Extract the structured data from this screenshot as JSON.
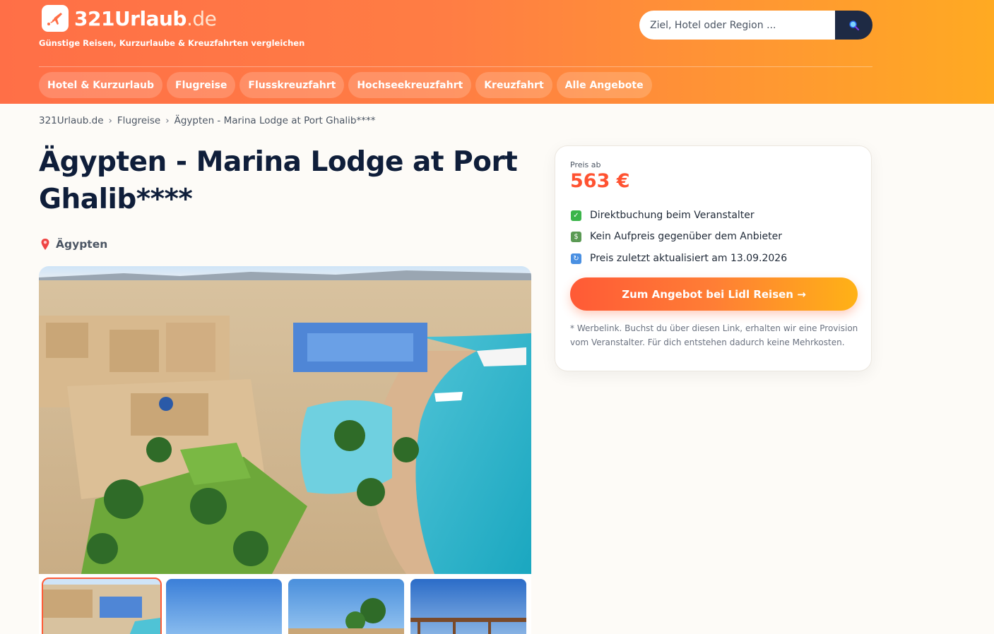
{
  "brand": {
    "name": "321Urlaub",
    "tld": ".de",
    "tagline": "Günstige Reisen, Kurzurlaube & Kreuzfahrten vergleichen"
  },
  "search": {
    "placeholder": "Ziel, Hotel oder Region ...",
    "value": "",
    "button_icon": "search-icon"
  },
  "nav": [
    "Hotel & Kurzurlaub",
    "Flugreise",
    "Flusskreuzfahrt",
    "Hochseekreuzfahrt",
    "Kreuzfahrt",
    "Alle Angebote"
  ],
  "breadcrumb": [
    "321Urlaub.de",
    "Flugreise",
    "Ägypten - Marina Lodge at Port Ghalib****"
  ],
  "hotel": {
    "title": "Ägypten - Marina Lodge at Port Ghalib****",
    "location": "Ägypten",
    "location_icon": "pin-icon"
  },
  "offer": {
    "price_label": "Preis ab",
    "price": "563 €",
    "features": [
      {
        "icon": "check-icon",
        "text": "Direktbuchung beim Veranstalter"
      },
      {
        "icon": "money-icon",
        "text": "Kein Aufpreis gegenüber dem Anbieter"
      },
      {
        "icon": "refresh-icon",
        "text": "Preis zuletzt aktualisiert am 13.09.2026"
      }
    ],
    "cta": "Zum Angebot bei Lidl Reisen →",
    "note": "* Werbelink. Buchst du über diesen Link, erhalten wir eine Provision vom Veranstalter. Für dich entstehen dadurch keine Mehrkosten."
  },
  "colors": {
    "accent": "#ff5231",
    "header_start": "#ff6f47",
    "header_end": "#ffaa22",
    "title": "#0f1e3a"
  }
}
